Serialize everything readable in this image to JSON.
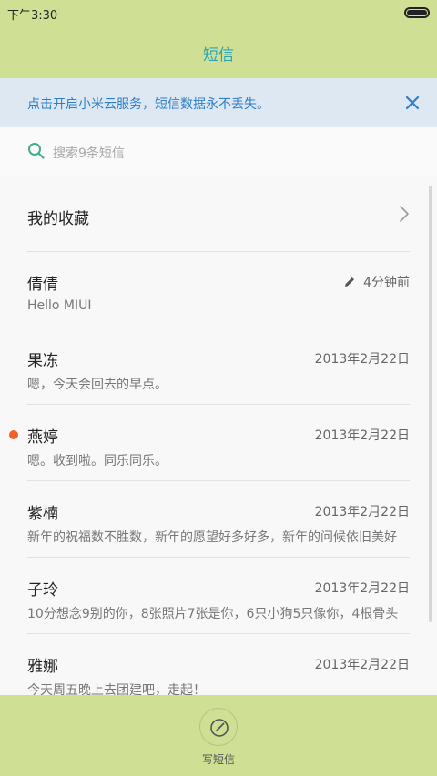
{
  "status_bar": {
    "time": "下午3:30"
  },
  "header": {
    "title": "短信"
  },
  "banner": {
    "text": "点击开启小米云服务，短信数据永不丢失。"
  },
  "search": {
    "placeholder": "搜索9条短信"
  },
  "favorites": {
    "label": "我的收藏"
  },
  "conversations": [
    {
      "name": "倩倩",
      "time": "4分钟前",
      "preview": "Hello MIUI",
      "draft": true,
      "unread": false
    },
    {
      "name": "果冻",
      "time": "2013年2月22日",
      "preview": "嗯，今天会回去的早点。",
      "draft": false,
      "unread": false
    },
    {
      "name": "燕婷",
      "time": "2013年2月22日",
      "preview": "嗯。收到啦。同乐同乐。",
      "draft": false,
      "unread": true
    },
    {
      "name": "紫楠",
      "time": "2013年2月22日",
      "preview": "新年的祝福数不胜数，新年的愿望好多好多，新年的问候依旧美好",
      "draft": false,
      "unread": false
    },
    {
      "name": "子玲",
      "time": "2013年2月22日",
      "preview": "10分想念9别的你，8张照片7张是你，6只小狗5只像你，4根骨头",
      "draft": false,
      "unread": false
    },
    {
      "name": "雅娜",
      "time": "2013年2月22日",
      "preview": "今天周五晚上去团建吧，走起！",
      "draft": false,
      "unread": false
    }
  ],
  "bottom_bar": {
    "compose_label": "写短信"
  },
  "colors": {
    "bar_background": "#cfe095",
    "title_text": "#2aa3b9",
    "banner_background": "#dde8f2",
    "banner_text": "#2e7ec9",
    "unread_dot": "#f1612a"
  }
}
